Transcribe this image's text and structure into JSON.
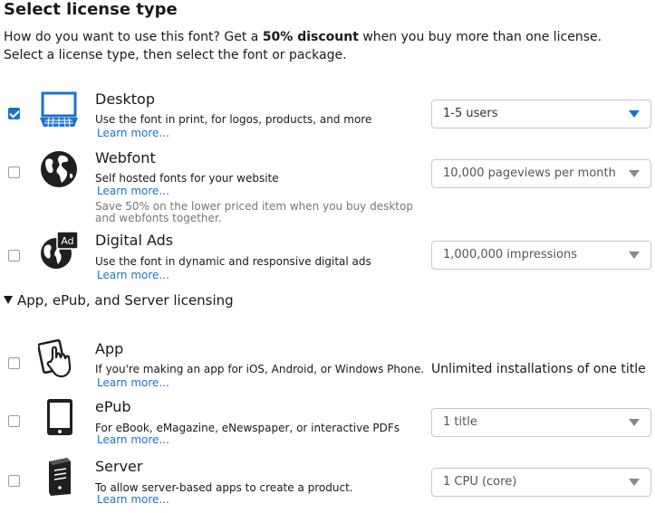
{
  "title": "Select license type",
  "intro": {
    "line1_pre": "How do you want to use this font? Get a ",
    "line1_bold": "50% discount",
    "line1_post": " when you buy more than one license.",
    "line2": "Select a license type, then  select the font or package."
  },
  "learn_more": "Learn more...",
  "licenses": {
    "desktop": {
      "name": "Desktop",
      "desc": "Use the font in print, for logos, products, and more",
      "selected": "1-5 users",
      "checked": true,
      "icon": "laptop-icon"
    },
    "webfont": {
      "name": "Webfont",
      "desc": "Self hosted fonts for your website",
      "selected": "10,000 pageviews per month",
      "checked": false,
      "icon": "globe-icon",
      "note": "Save 50% on the lower priced item when you buy desktop and webfonts together."
    },
    "digital_ads": {
      "name": "Digital Ads",
      "desc": "Use the font in dynamic and responsive digital ads",
      "selected": "1,000,000 impressions",
      "checked": false,
      "icon": "globe-ad-icon",
      "badge": "Ad"
    },
    "app": {
      "name": "App",
      "desc": "If you're making an app for iOS, Android, or Windows Phone.",
      "value": "Unlimited installations of one title",
      "checked": false,
      "icon": "touch-app-icon"
    },
    "epub": {
      "name": "ePub",
      "desc": "For eBook, eMagazine, eNewspaper, or interactive PDFs",
      "selected": "1 title",
      "checked": false,
      "icon": "tablet-icon"
    },
    "server": {
      "name": "Server",
      "desc": "To allow server-based apps to create a product.",
      "selected": "1 CPU (core)",
      "checked": false,
      "icon": "server-icon"
    }
  },
  "section": {
    "label": "App, ePub, and Server licensing",
    "expanded": true
  },
  "colors": {
    "accent": "#1a73c8",
    "text": "#1a1a1a",
    "muted": "#777777"
  }
}
